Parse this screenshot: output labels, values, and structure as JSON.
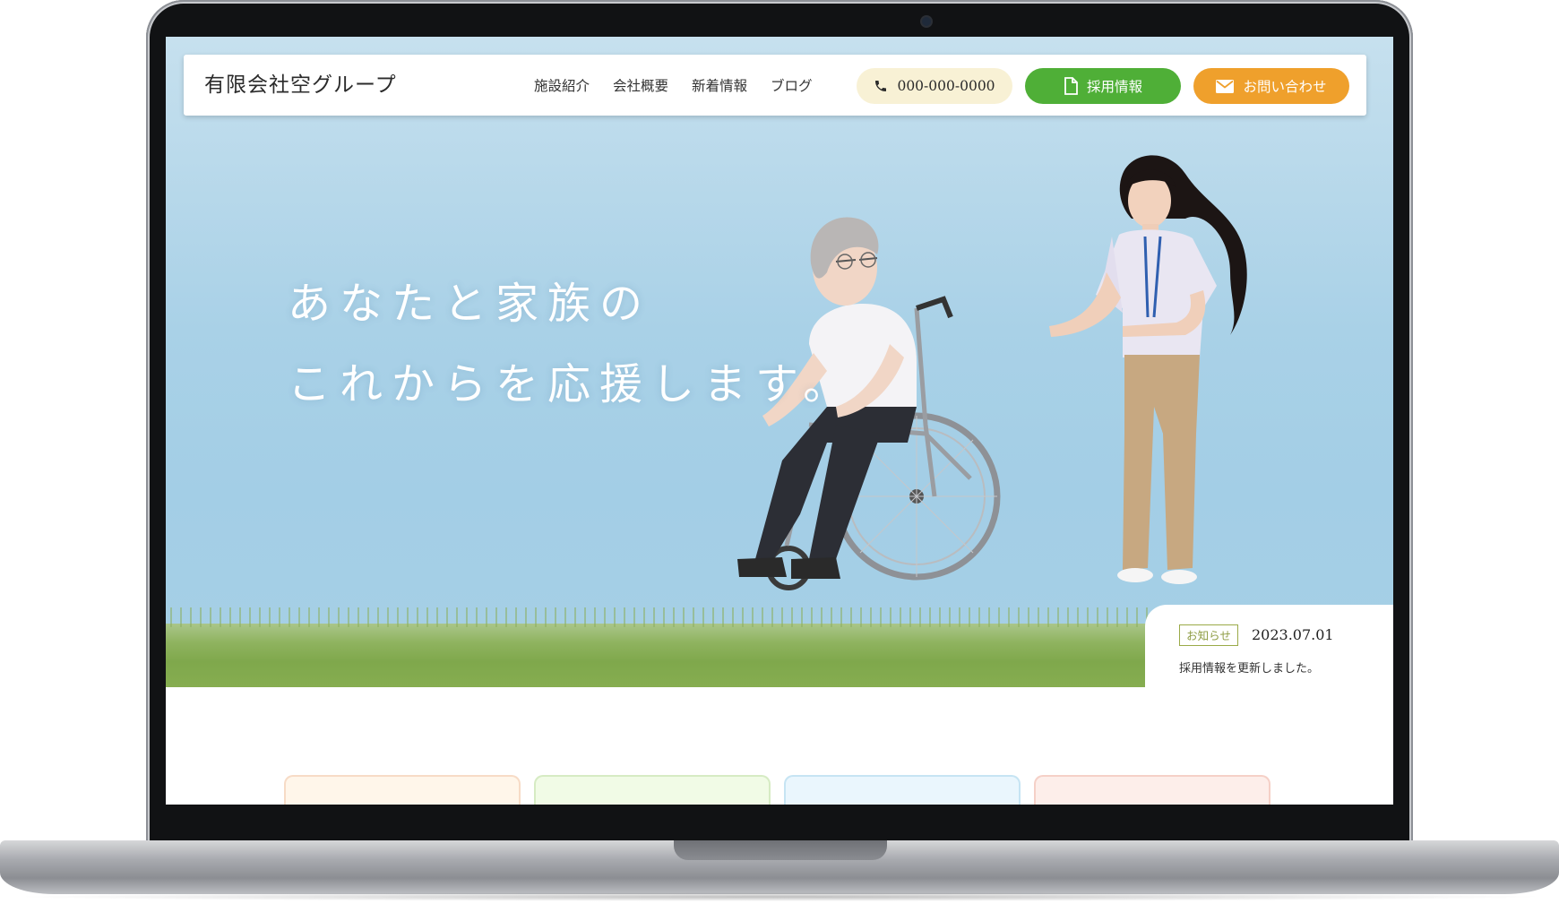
{
  "header": {
    "logo": "有限会社空グループ",
    "nav": [
      "施設紹介",
      "会社概要",
      "新着情報",
      "ブログ"
    ],
    "phone_label": "000-000-0000",
    "recruit_label": "採用情報",
    "contact_label": "お問い合わせ"
  },
  "hero": {
    "catch_line1": "あなたと家族の",
    "catch_line2": "これからを応援します。"
  },
  "notice": {
    "tag": "お知らせ",
    "date": "2023.07.01",
    "text": "採用情報を更新しました。"
  },
  "colors": {
    "recruit": "#4faf37",
    "contact": "#efa02c",
    "phone_bg": "#f8f1d5",
    "notice_tag": "#8e9c43"
  },
  "icons": [
    "phone-icon",
    "document-icon",
    "mail-icon"
  ]
}
